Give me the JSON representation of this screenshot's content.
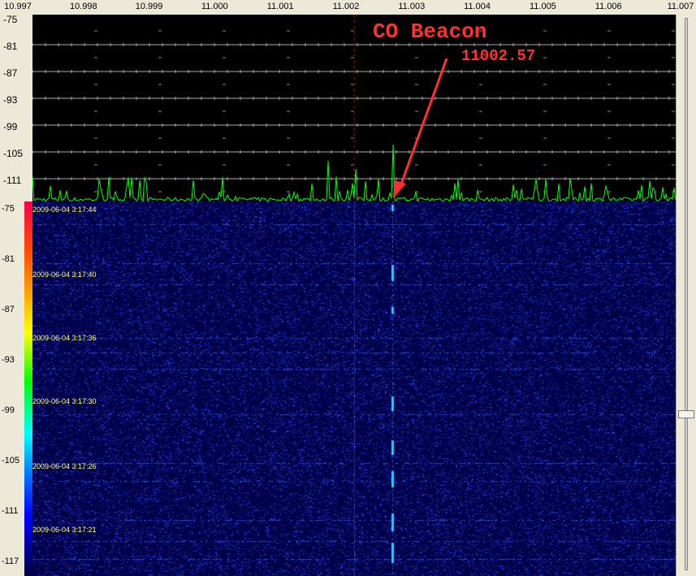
{
  "frequency_axis": {
    "labels": [
      "10.997",
      "10.998",
      "10.999",
      "11.000",
      "11.001",
      "11.002",
      "11.003",
      "11.004",
      "11.005",
      "11.006",
      "11.007"
    ]
  },
  "spectrum": {
    "db_labels": [
      "-75",
      "-81",
      "-87",
      "-93",
      "-99",
      "-105",
      "-111"
    ],
    "trace_color": "#00ff00",
    "grid_color": "#aaaaaa",
    "marker_color": "#cc0000"
  },
  "waterfall": {
    "db_labels": [
      "-75",
      "-81",
      "-87",
      "-93",
      "-99",
      "-105",
      "-111",
      "-117"
    ],
    "timestamps": [
      "2009-06-04 3:17:44",
      "2009-06-04 3:17:40",
      "2009-06-04 3:17:36",
      "2009-06-04 3:17:30",
      "2009-06-04 3:17:26",
      "2009-06-04 3:17:21"
    ],
    "background_color": "#00004a",
    "signal_color": "#40c0ff"
  },
  "annotation": {
    "title": "CO Beacon",
    "frequency": "11002.57",
    "color": "#ff3030"
  }
}
